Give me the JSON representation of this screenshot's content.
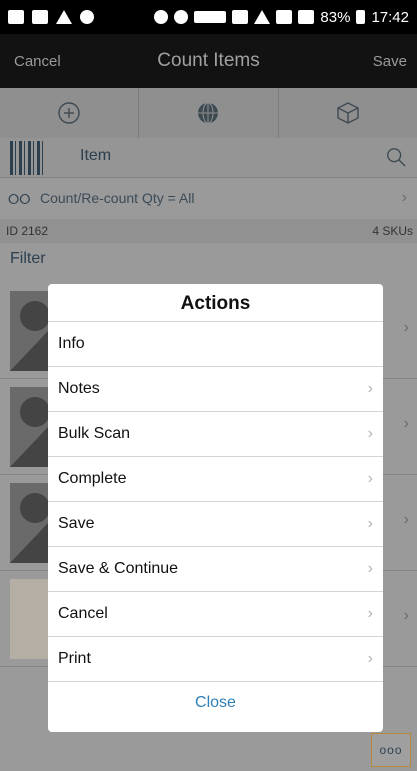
{
  "status_bar": {
    "battery": "83%",
    "time": "17:42"
  },
  "header": {
    "cancel_label": "Cancel",
    "title": "Count Items",
    "save_label": "Save"
  },
  "item_search": {
    "label": "Item"
  },
  "count_filter": {
    "label": "Count/Re-count Qty = All"
  },
  "info": {
    "id": "ID 2162",
    "skus": "4 SKUs"
  },
  "filter_label": "Filter",
  "fab_label": "ooo",
  "dialog": {
    "title": "Actions",
    "actions": [
      {
        "label": "Info"
      },
      {
        "label": "Notes"
      },
      {
        "label": "Bulk Scan"
      },
      {
        "label": "Complete"
      },
      {
        "label": "Save"
      },
      {
        "label": "Save & Continue"
      },
      {
        "label": "Cancel"
      },
      {
        "label": "Print"
      }
    ],
    "close_label": "Close"
  },
  "icons": {
    "add": "plus-circle-icon",
    "sphere": "sphere-icon",
    "box": "box-icon",
    "barcode": "barcode-icon",
    "search": "search-icon",
    "glasses": "glasses-icon"
  },
  "colors": {
    "close_link": "#2f7fb8",
    "accent_dark": "#2c3f4f"
  }
}
